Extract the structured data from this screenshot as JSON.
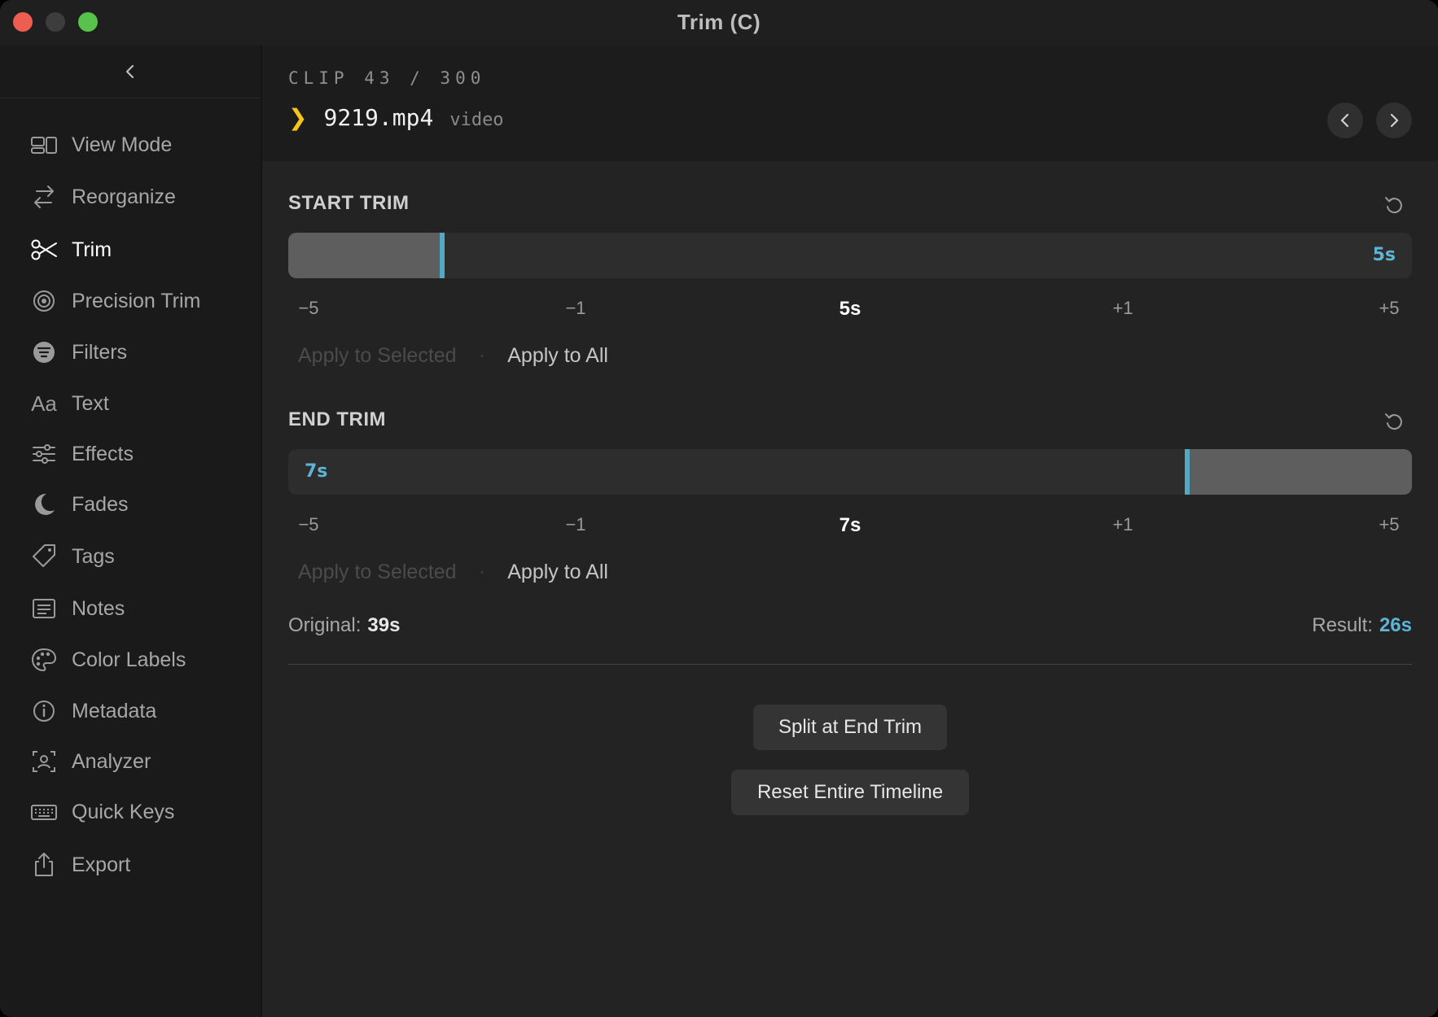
{
  "window": {
    "title": "Trim  (C)"
  },
  "sidebar": {
    "items": [
      {
        "label": "View Mode",
        "icon": "view-mode-icon"
      },
      {
        "label": "Reorganize",
        "icon": "reorganize-icon"
      },
      {
        "label": "Trim",
        "icon": "scissors-icon",
        "active": true
      },
      {
        "label": "Precision Trim",
        "icon": "target-icon"
      },
      {
        "label": "Filters",
        "icon": "filters-icon"
      },
      {
        "label": "Text",
        "icon": "text-icon",
        "glyph": "Aa"
      },
      {
        "label": "Effects",
        "icon": "sliders-icon"
      },
      {
        "label": "Fades",
        "icon": "moon-icon"
      },
      {
        "label": "Tags",
        "icon": "tag-icon"
      },
      {
        "label": "Notes",
        "icon": "notes-icon"
      },
      {
        "label": "Color Labels",
        "icon": "palette-icon"
      },
      {
        "label": "Metadata",
        "icon": "info-icon"
      },
      {
        "label": "Analyzer",
        "icon": "analyzer-icon"
      },
      {
        "label": "Quick Keys",
        "icon": "keyboard-icon"
      },
      {
        "label": "Export",
        "icon": "export-icon"
      }
    ]
  },
  "header": {
    "clip_counter": "CLIP 43 / 300",
    "chevron": "❯",
    "filename": "9219.mp4",
    "filetype": "video"
  },
  "start_trim": {
    "title": "START TRIM",
    "value_label": "5s",
    "position_fraction": 0.137,
    "ticks": [
      "−5",
      "−1",
      "5s",
      "+1",
      "+5"
    ],
    "apply_selected": "Apply to Selected",
    "separator": "·",
    "apply_all": "Apply to All"
  },
  "end_trim": {
    "title": "END TRIM",
    "value_label": "7s",
    "position_fraction": 0.8,
    "ticks": [
      "−5",
      "−1",
      "7s",
      "+1",
      "+5"
    ],
    "apply_selected": "Apply to Selected",
    "separator": "·",
    "apply_all": "Apply to All"
  },
  "summary": {
    "original_label": "Original:",
    "original_value": "39s",
    "result_label": "Result:",
    "result_value": "26s"
  },
  "actions": {
    "split_label": "Split at End Trim",
    "reset_label": "Reset Entire Timeline"
  },
  "colors": {
    "accent": "#52a9c4",
    "accent_text": "#5db4d6",
    "chevron": "#f5c518"
  }
}
